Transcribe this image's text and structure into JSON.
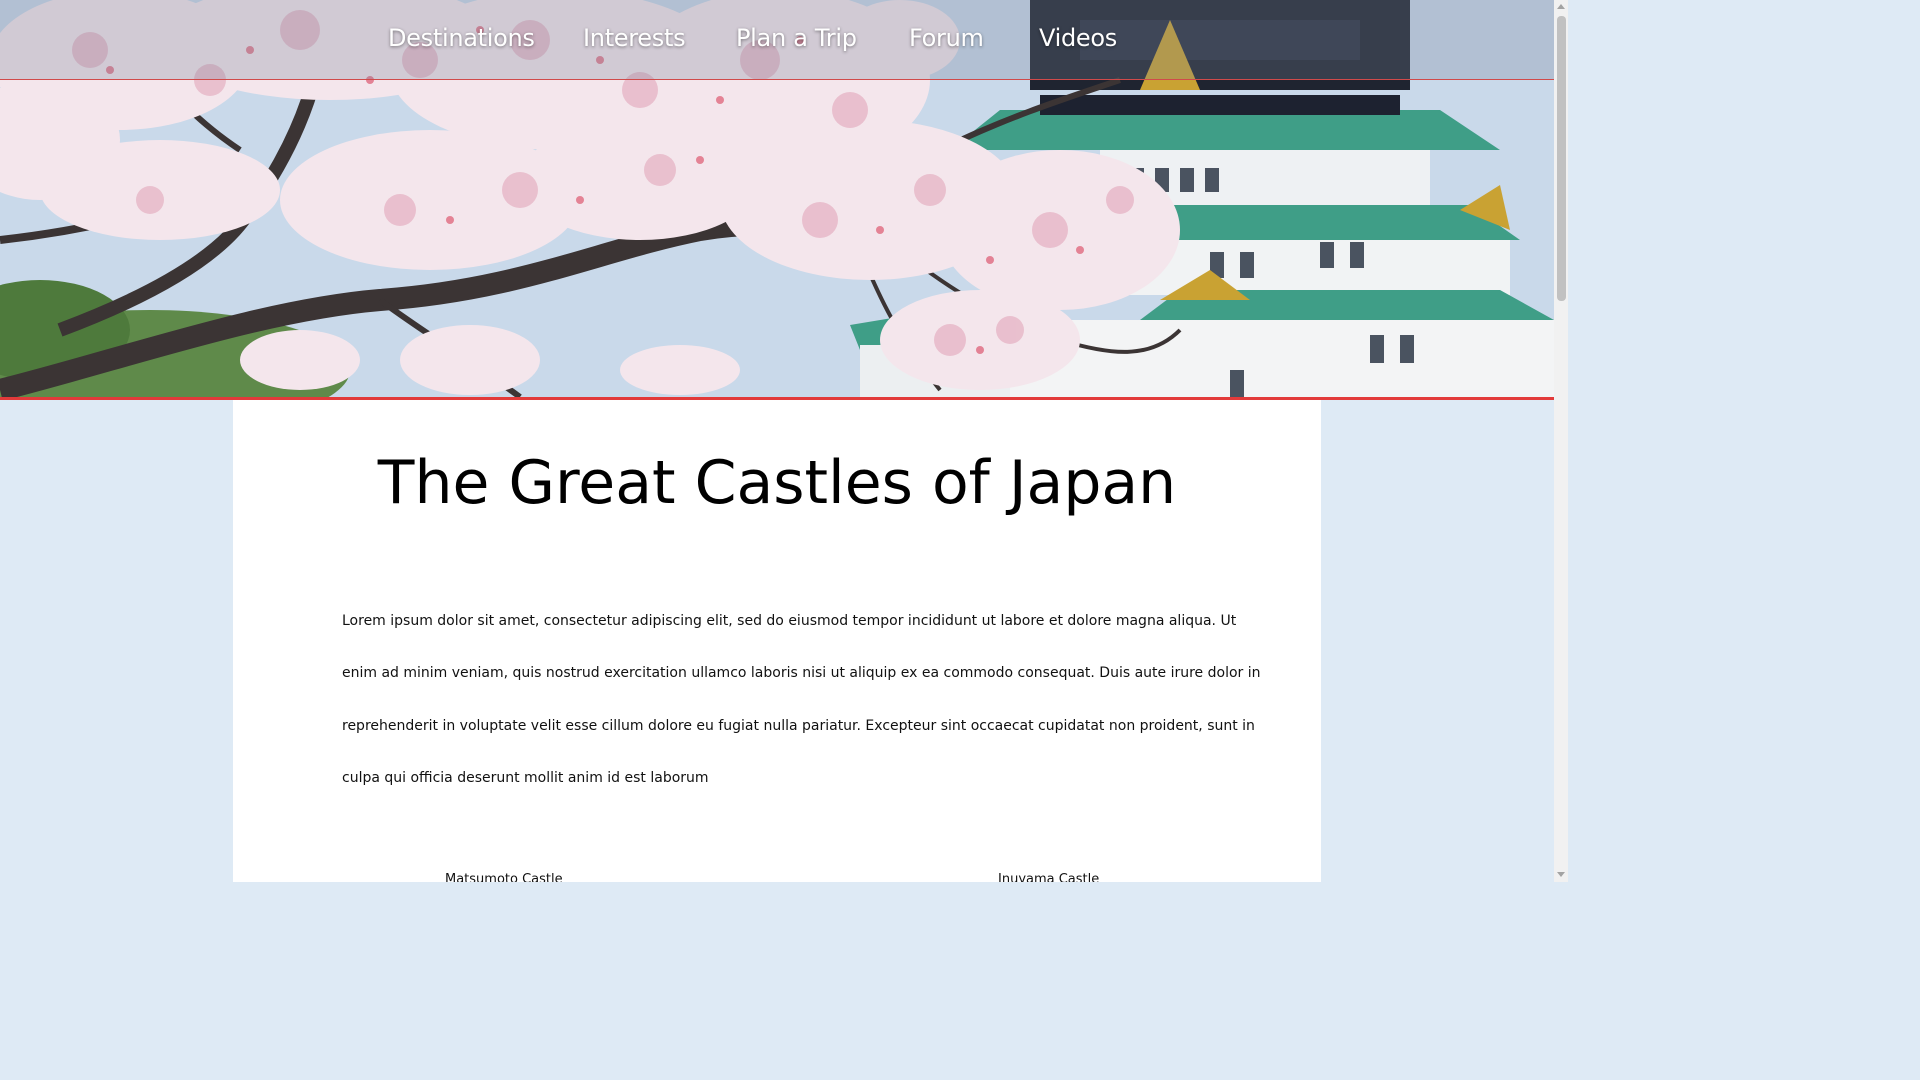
{
  "nav": {
    "items": [
      {
        "label": "Destinations"
      },
      {
        "label": "Interests"
      },
      {
        "label": "Plan a Trip"
      },
      {
        "label": "Forum"
      },
      {
        "label": "Videos"
      }
    ]
  },
  "hero": {
    "image": "cherry-blossoms-and-castle"
  },
  "main": {
    "title": "The Great Castles of Japan",
    "paragraph_lines": [
      "Lorem ipsum dolor sit amet, consectetur adipiscing elit, sed do eiusmod tempor incididunt ut labore et dolore magna aliqua. Ut",
      "enim ad minim veniam, quis nostrud exercitation ullamco laboris nisi ut aliquip ex ea commodo consequat. Duis aute irure dolor in",
      "reprehenderit in voluptate velit esse cillum dolore eu fugiat nulla pariatur. Excepteur sint occaecat cupidatat non proident, sunt in",
      "culpa qui officia deserunt mollit anim id est laborum"
    ],
    "captions": [
      "Matsumoto Castle",
      "Inuyama Castle"
    ]
  },
  "colors": {
    "accent": "#e23a3a",
    "page_background": "#deeaf5",
    "card_background": "#ffffff",
    "castle_roof": "#3f9e87"
  }
}
